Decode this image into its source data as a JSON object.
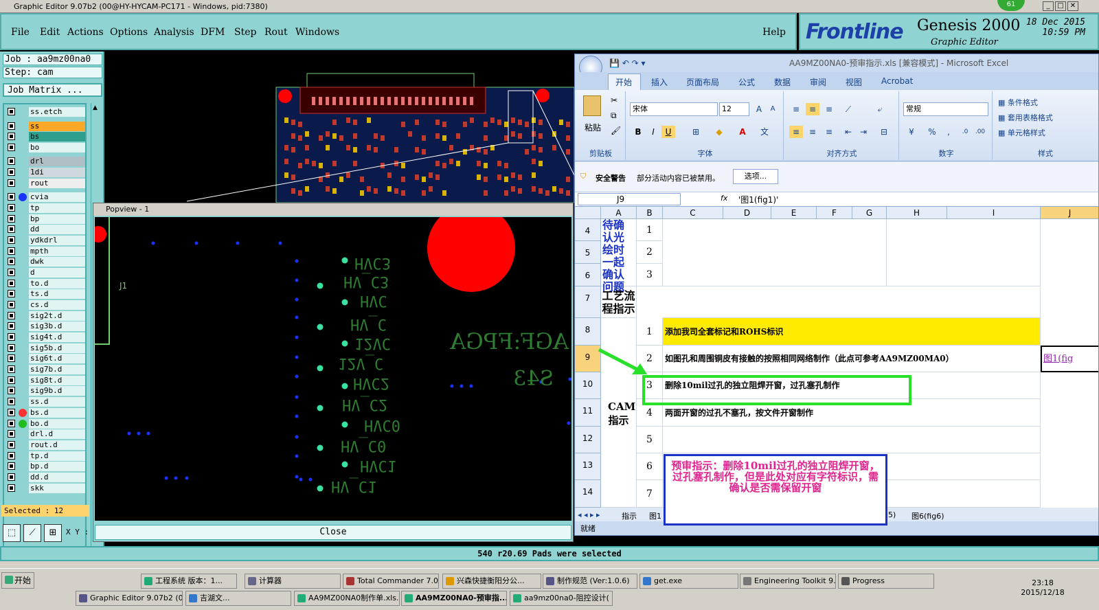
{
  "window": {
    "title": "Graphic Editor 9.07b2 (00@HY-HYCAM-PC171 - Windows, pid:7380)",
    "badge": "61"
  },
  "menu": {
    "items": [
      "File",
      "Edit",
      "Actions",
      "Options",
      "Analysis",
      "DFM",
      "Step",
      "Rout",
      "Windows"
    ],
    "help": "Help"
  },
  "brand": {
    "logo": "Frontline",
    "product": "Genesis 2000",
    "subtitle": "Graphic Editor",
    "date": "18 Dec 2015",
    "time": "10:59 PM"
  },
  "job": {
    "job": "Job : aa9mz00na0",
    "step": "Step: cam",
    "matrix": "Job Matrix ..."
  },
  "layers": [
    "ss.etch",
    "ss",
    "bs",
    "bo",
    "drl",
    "1di",
    "rout",
    "cvia",
    "tp",
    "bp",
    "dd",
    "ydkdrl",
    "mpth",
    "dwk",
    "d",
    "to.d",
    "ts.d",
    "cs.d",
    "sig2t.d",
    "sig3b.d",
    "sig4t.d",
    "sig5b.d",
    "sig6t.d",
    "sig7b.d",
    "sig8t.d",
    "sig9b.d",
    "ss.d",
    "bs.d",
    "bo.d",
    "drl.d",
    "rout.d",
    "tp.d",
    "bp.d",
    "dd.d",
    "skk"
  ],
  "status": {
    "selected": "Selected : 12",
    "xy": "X Y :",
    "message": "540 r20.69 Pads were selected"
  },
  "popview": {
    "title": "Popview - 1",
    "close": "Close",
    "labels": [
      "HVC3",
      "HV_C3",
      "HVC",
      "HV_C",
      "12VC",
      "12V_C",
      "HVC2",
      "HV_C2",
      "HVC0",
      "HV_C0",
      "HVC1",
      "HV_C1"
    ],
    "fpga": "AGF:FPGA",
    "num": "S43",
    "ref": "J1"
  },
  "excel": {
    "title": "AA9MZ00NA0-预审指示.xls [兼容模式] - Microsoft Excel",
    "tabs": [
      "开始",
      "插入",
      "页面布局",
      "公式",
      "数据",
      "审阅",
      "视图",
      "Acrobat"
    ],
    "font": "宋体",
    "size": "12",
    "numfmt": "常规",
    "groups": [
      "剪贴板",
      "字体",
      "对齐方式",
      "数字",
      "样式"
    ],
    "paste": "粘贴",
    "styles": [
      "条件格式",
      "套用表格格式",
      "单元格样式"
    ],
    "warn_title": "安全警告",
    "warn_text": "部分活动内容已被禁用。",
    "warn_btn": "选项...",
    "namebox": "J9",
    "fx": "fx",
    "formula": "'图1(fig1)'",
    "cols": [
      "A",
      "B",
      "C",
      "D",
      "E",
      "F",
      "G",
      "H",
      "I",
      "J"
    ],
    "rows": [
      "4",
      "5",
      "6",
      "7",
      "8",
      "9",
      "10",
      "11",
      "12",
      "13",
      "14"
    ],
    "a_block1": "待确认光绘时一起确认问题",
    "a_block2": "工艺流程指示",
    "a_block3": "CAM指示",
    "b_nums": [
      "1",
      "2",
      "3",
      "1",
      "2",
      "3",
      "4",
      "5",
      "6",
      "7"
    ],
    "item1": "添加我司全套标记和ROHS标识",
    "item2": "如图孔和周围铜皮有接触的按照相同网络制作（此点可参考AA9MZ00MA0）",
    "item3": "删除10mil过孔的独立阻焊开窗，过孔塞孔制作",
    "item4": "两面开窗的过孔不塞孔，按文件开窗制作",
    "link": "图1(fig",
    "sheets": [
      "指示",
      "图1",
      "5)",
      "图6(fig6)"
    ],
    "ready": "就绪",
    "callout": "预审指示：删除10mil过孔的独立阻焊开窗，过孔塞孔制作，但是此处对应有字符标识，需确认是否需保留开窗"
  },
  "taskbar": {
    "start": "开始",
    "row1": [
      "工程系统 版本：1...",
      "计算器",
      "Total Commander 7.0...",
      "兴森快捷衡阳分公...",
      "制作规范 (Ver:1.0.6)",
      "get.exe",
      "Engineering Toolkit 9....",
      "Progress"
    ],
    "row2": [
      "Graphic Editor 9.07b2 (0...",
      "吉湖文...",
      "AA9MZ00NA0制作单.xls...",
      "AA9MZ00NA0-预审指...",
      "aa9mz00na0-阻控设计("
    ],
    "time": "23:18",
    "date": "2015/12/18"
  }
}
